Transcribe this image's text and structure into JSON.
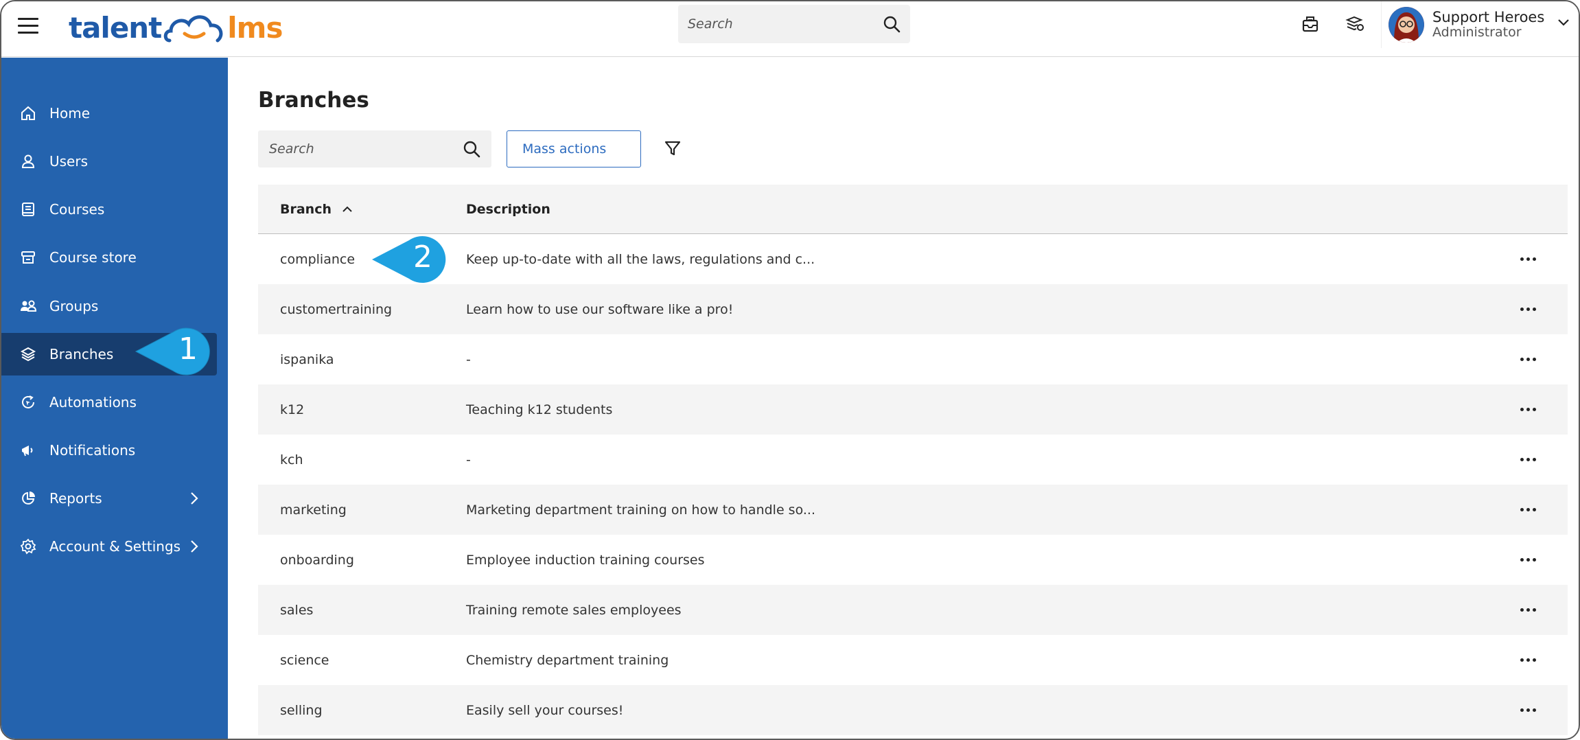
{
  "app": {
    "logo_left": "talent",
    "logo_right": "lms"
  },
  "topbar": {
    "search_placeholder": "Search",
    "user_name": "Support Heroes",
    "user_role": "Administrator"
  },
  "sidebar": {
    "items": [
      {
        "label": "Home",
        "icon": "home-icon"
      },
      {
        "label": "Users",
        "icon": "user-icon"
      },
      {
        "label": "Courses",
        "icon": "book-icon"
      },
      {
        "label": "Course store",
        "icon": "store-icon"
      },
      {
        "label": "Groups",
        "icon": "groups-icon"
      },
      {
        "label": "Branches",
        "icon": "layers-icon",
        "active": true
      },
      {
        "label": "Automations",
        "icon": "automation-icon"
      },
      {
        "label": "Notifications",
        "icon": "megaphone-icon"
      },
      {
        "label": "Reports",
        "icon": "pie-chart-icon",
        "has_submenu": true
      },
      {
        "label": "Account & Settings",
        "icon": "gear-icon",
        "has_submenu": true
      }
    ]
  },
  "callouts": [
    {
      "number": "1",
      "color": "#1fa1e0"
    },
    {
      "number": "2",
      "color": "#1fa1e0"
    }
  ],
  "main": {
    "title": "Branches",
    "search_placeholder": "Search",
    "mass_actions_label": "Mass actions"
  },
  "table": {
    "columns": [
      "Branch",
      "Description"
    ],
    "sort_column": "Branch",
    "sort_direction": "ascending",
    "rows": [
      {
        "branch": "compliance",
        "description": "Keep up-to-date with all the laws, regulations and c..."
      },
      {
        "branch": "customertraining",
        "description": "Learn how to use our software like a pro!"
      },
      {
        "branch": "ispanika",
        "description": "-"
      },
      {
        "branch": "k12",
        "description": "Teaching k12 students"
      },
      {
        "branch": "kch",
        "description": "-"
      },
      {
        "branch": "marketing",
        "description": "Marketing department training on how to handle so..."
      },
      {
        "branch": "onboarding",
        "description": "Employee induction training courses"
      },
      {
        "branch": "sales",
        "description": "Training remote sales employees"
      },
      {
        "branch": "science",
        "description": "Chemistry department training"
      },
      {
        "branch": "selling",
        "description": "Easily sell your courses!"
      }
    ]
  },
  "colors": {
    "sidebar_bg": "#2463ae",
    "sidebar_active_bg": "#173d6e",
    "brand_blue": "#1f5aa8",
    "brand_orange": "#f08a1e",
    "callout_blue": "#1fa1e0"
  }
}
